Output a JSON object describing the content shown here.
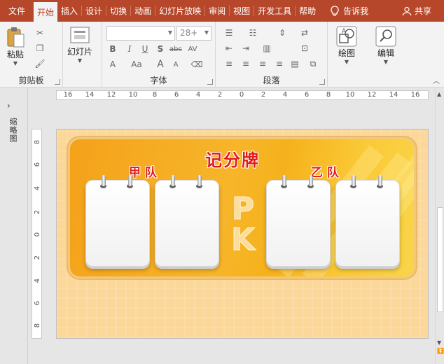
{
  "menu": {
    "tabs": [
      "文件",
      "开始",
      "插入",
      "设计",
      "切换",
      "动画",
      "幻灯片放映",
      "审阅",
      "视图",
      "开发工具",
      "帮助"
    ],
    "active_tab": "开始",
    "tell_me": "告诉我",
    "share": "共享"
  },
  "ribbon": {
    "clipboard": {
      "label": "剪贴板",
      "paste": "粘贴"
    },
    "slides": {
      "new_slide": "幻灯片"
    },
    "font": {
      "label": "字体",
      "size_value": "28+",
      "bold": "B",
      "italic": "I",
      "underline": "U",
      "shadow": "S",
      "strike": "abc",
      "spacing": "AV",
      "font_color": "A",
      "change_case": "Aa",
      "grow": "A",
      "shrink": "A"
    },
    "paragraph": {
      "label": "段落"
    },
    "drawing": {
      "label": "绘图"
    },
    "editing": {
      "label": "编辑"
    }
  },
  "leftpane": {
    "label": "缩略图"
  },
  "ruler": {
    "h_numbers": [
      "16",
      "14",
      "12",
      "10",
      "8",
      "6",
      "4",
      "2",
      "0",
      "2",
      "4",
      "6",
      "8",
      "10",
      "12",
      "14",
      "16"
    ],
    "v_numbers": [
      "8",
      "6",
      "4",
      "2",
      "0",
      "2",
      "4",
      "6",
      "8"
    ]
  },
  "slide": {
    "title": "记分牌",
    "team_a": "甲队",
    "team_b": "乙队",
    "pk": [
      "P",
      "K"
    ]
  },
  "colors": {
    "accent": "#b7472a",
    "title_red": "#e11b1b"
  }
}
